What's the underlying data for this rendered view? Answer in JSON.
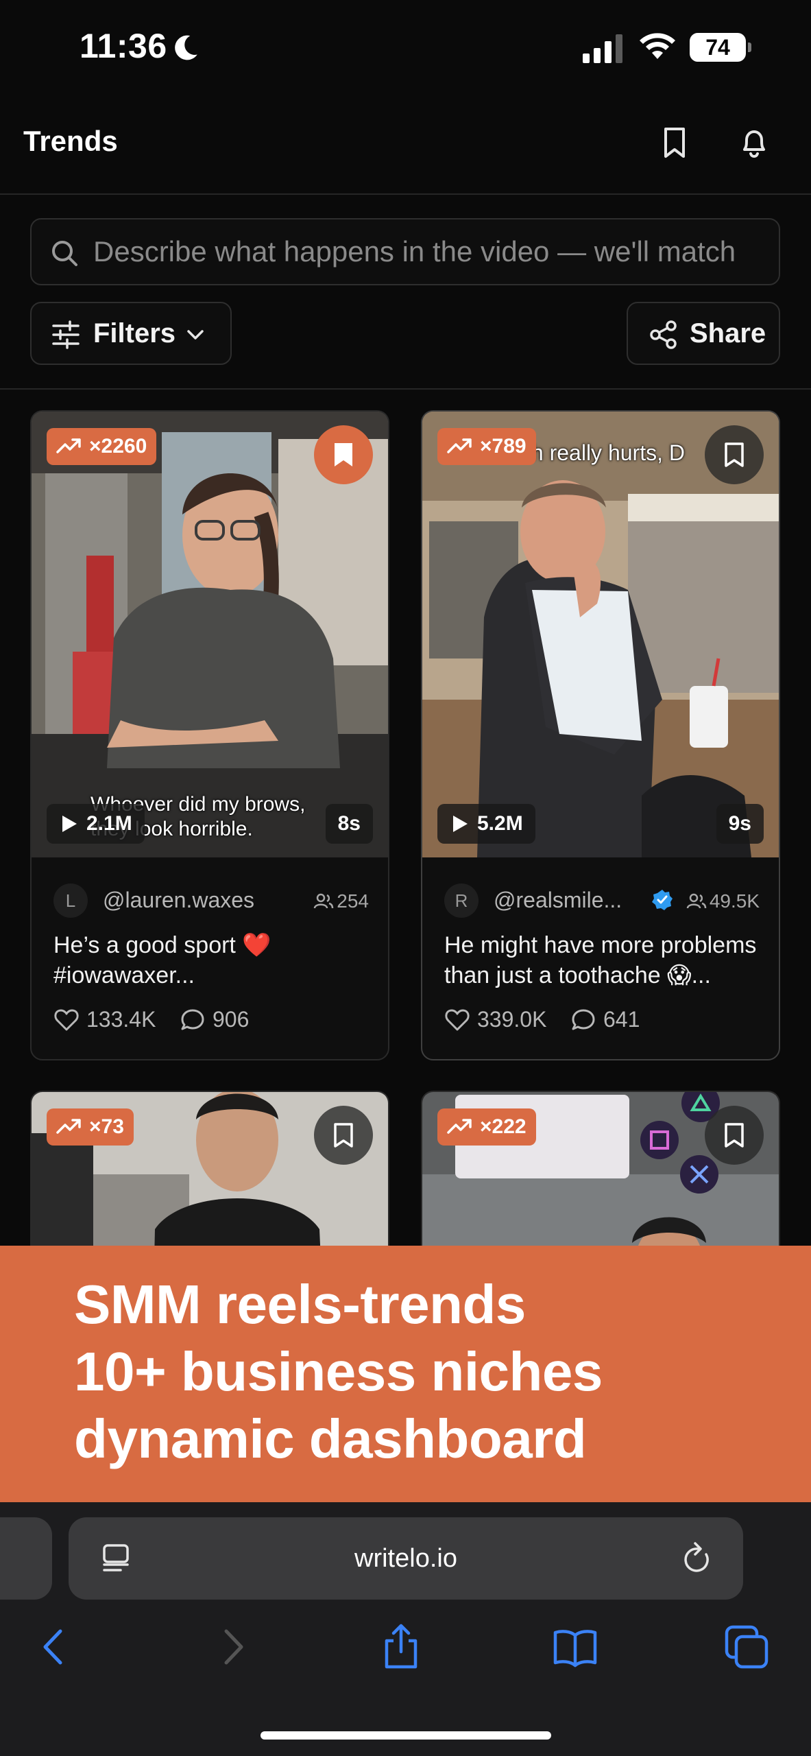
{
  "status_bar": {
    "time": "11:36",
    "battery": "74"
  },
  "header": {
    "title": "Trends"
  },
  "search": {
    "placeholder": "Describe what happens in the video — we'll match"
  },
  "toolbar": {
    "filters_label": "Filters",
    "share_label": "Share"
  },
  "cards": [
    {
      "trend": "×2260",
      "saved": true,
      "overlay_caption": "Whoever did my brows, they look horrible.",
      "views": "2.1M",
      "duration": "8s",
      "avatar": "L",
      "handle": "@lauren.waxes",
      "verified": false,
      "followers": "254",
      "description": "He’s a good sport ❤️ #iowawaxer...",
      "likes": "133.4K",
      "comments": "906"
    },
    {
      "trend": "×789",
      "saved": false,
      "overlay_caption": "th really hurts, D",
      "views": "5.2M",
      "duration": "9s",
      "avatar": "R",
      "handle": "@realsmile...",
      "verified": true,
      "followers": "49.5K",
      "description": "He might have more problems than just a toothache 😱...",
      "likes": "339.0K",
      "comments": "641"
    },
    {
      "trend": "×73",
      "saved": false
    },
    {
      "trend": "×222",
      "saved": false
    }
  ],
  "promo": {
    "line1": "SMM reels-trends",
    "line2": "10+ business niches",
    "line3": "dynamic dashboard",
    "color": "#d86b42"
  },
  "browser": {
    "url": "writelo.io"
  },
  "colors": {
    "accent": "#d96b43",
    "background": "#0a0a0a",
    "link_blue": "#3b82f6"
  },
  "icons": {
    "status": [
      "moon-icon",
      "signal-icon",
      "wifi-icon",
      "battery-icon"
    ],
    "header": [
      "bookmark-icon",
      "bell-icon"
    ],
    "toolbar": [
      "sliders-icon",
      "chevron-down-icon",
      "share-icon"
    ],
    "browser": [
      "reader-icon",
      "reload-icon",
      "back-icon",
      "forward-icon",
      "share-up-icon",
      "book-icon",
      "tabs-icon"
    ]
  }
}
